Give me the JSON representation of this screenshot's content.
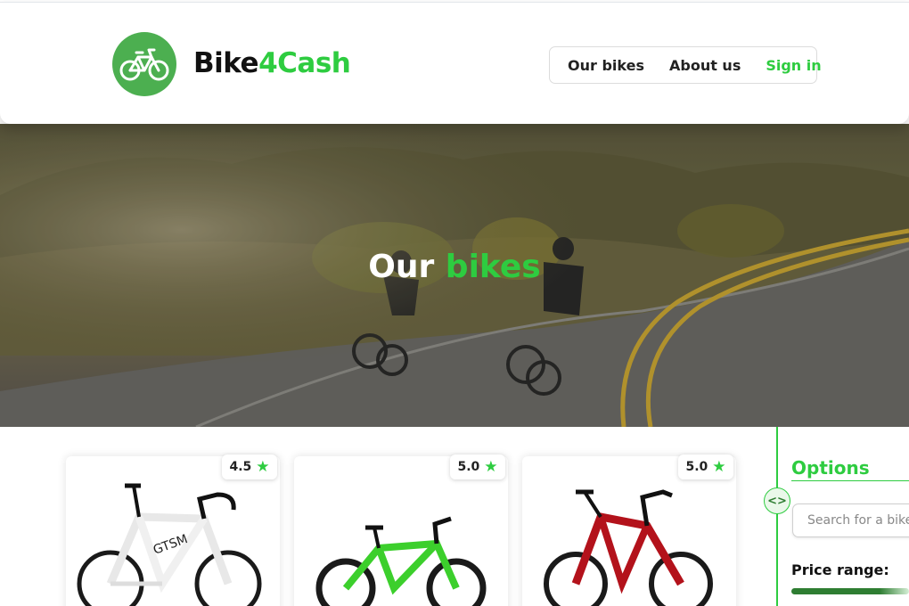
{
  "brand": {
    "part1": "Bike",
    "part2": "4Cash"
  },
  "nav": {
    "item1": "Our bikes",
    "item2": "About us",
    "item3": "Sign in"
  },
  "hero": {
    "title_white": "Our",
    "title_green": "bikes"
  },
  "products": [
    {
      "rating": "4.5"
    },
    {
      "rating": "5.0"
    },
    {
      "rating": "5.0"
    }
  ],
  "options": {
    "title": "Options",
    "search_placeholder": "Search for a bike",
    "price_label": "Price range:"
  },
  "colors": {
    "accent": "#2ecc40",
    "logo_bg": "#4caf50"
  },
  "icons": {
    "logo": "bicycle-icon",
    "star": "star-icon",
    "toggle": "code-brackets-icon"
  }
}
